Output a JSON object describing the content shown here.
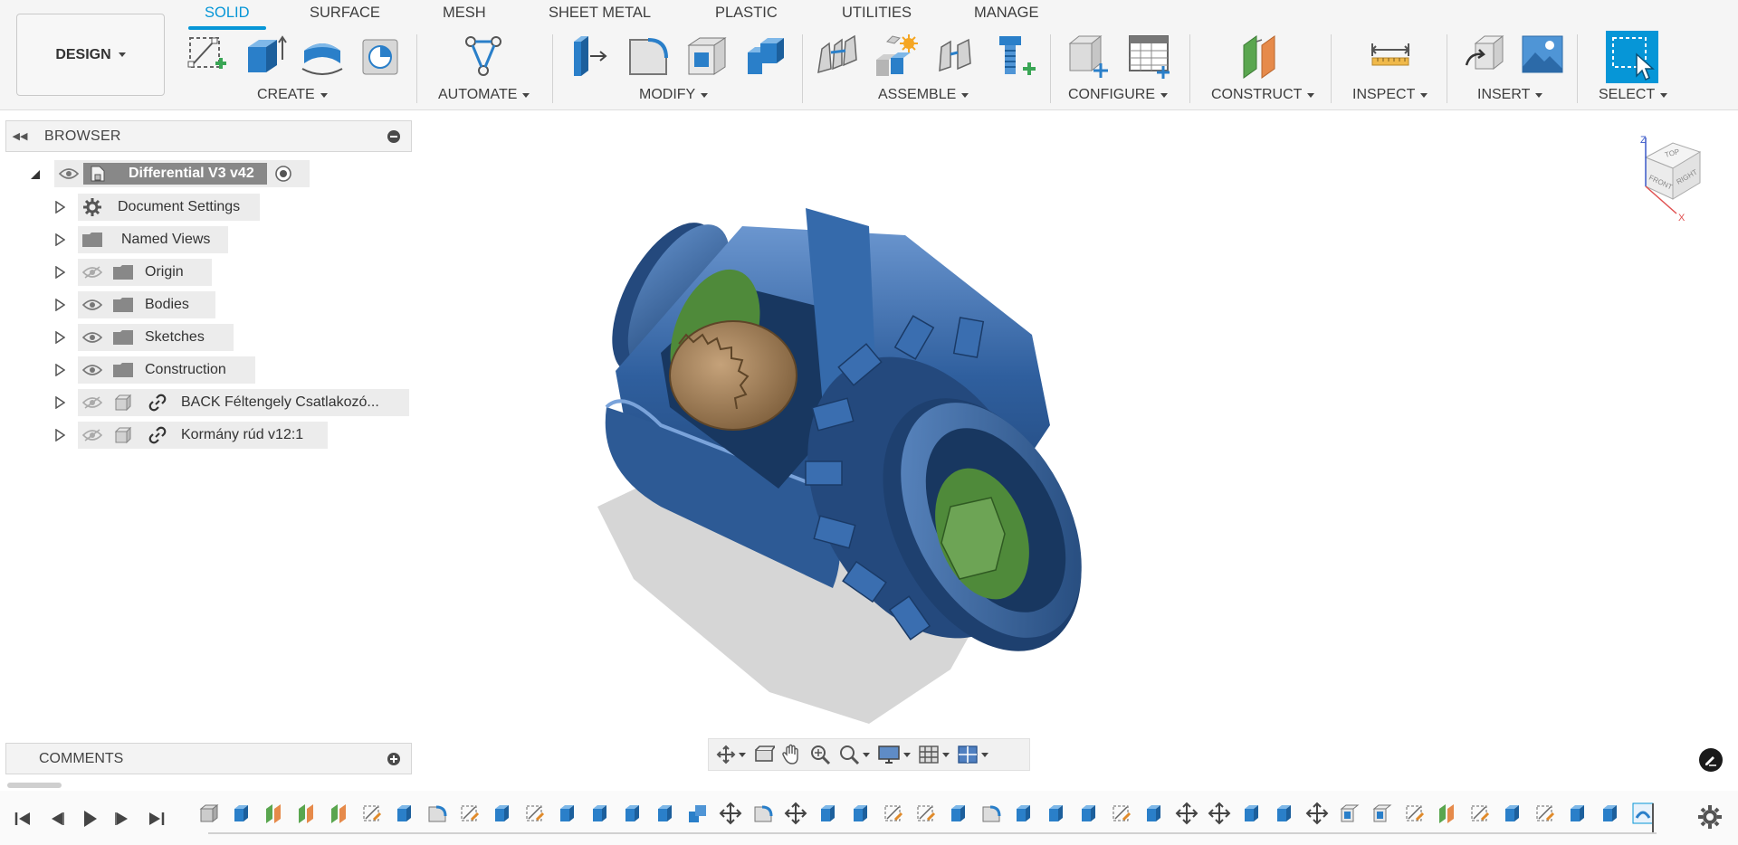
{
  "workspace": {
    "label": "DESIGN"
  },
  "tabs": [
    {
      "label": "SOLID",
      "active": true
    },
    {
      "label": "SURFACE",
      "active": false
    },
    {
      "label": "MESH",
      "active": false
    },
    {
      "label": "SHEET METAL",
      "active": false
    },
    {
      "label": "PLASTIC",
      "active": false
    },
    {
      "label": "UTILITIES",
      "active": false
    },
    {
      "label": "MANAGE",
      "active": false
    }
  ],
  "toolbar_groups": {
    "create": "CREATE",
    "automate": "AUTOMATE",
    "modify": "MODIFY",
    "assemble": "ASSEMBLE",
    "configure": "CONFIGURE",
    "construct": "CONSTRUCT",
    "inspect": "INSPECT",
    "insert": "INSERT",
    "select": "SELECT"
  },
  "toolbar_icons": {
    "create": [
      "create-sketch-icon",
      "extrude-icon",
      "revolve-icon",
      "hole-icon"
    ],
    "automate": [
      "automate-icon"
    ],
    "modify": [
      "press-pull-icon",
      "fillet-icon",
      "shell-icon",
      "combine-icon"
    ],
    "assemble": [
      "joint-icon",
      "new-component-icon",
      "as-built-joint-icon",
      "fastener-icon"
    ],
    "configure": [
      "configure-icon",
      "configuration-table-icon"
    ],
    "construct": [
      "offset-plane-icon"
    ],
    "inspect": [
      "measure-icon"
    ],
    "insert": [
      "insert-derive-icon",
      "insert-canvas-icon"
    ],
    "select": [
      "select-icon"
    ]
  },
  "browser": {
    "title": "BROWSER",
    "root": {
      "label": "Differential V3 v42"
    },
    "items": [
      {
        "label": "Document Settings",
        "icon": "gear-icon"
      },
      {
        "label": "Named Views",
        "icon": "folder-icon"
      },
      {
        "label": "Origin",
        "icon": "folder-icon",
        "visible": false
      },
      {
        "label": "Bodies",
        "icon": "folder-icon",
        "visible": true
      },
      {
        "label": "Sketches",
        "icon": "folder-icon",
        "visible": true
      },
      {
        "label": "Construction",
        "icon": "folder-icon",
        "visible": true
      },
      {
        "label": "BACK Féltengely Csatlakozó...",
        "icon": "component-icon",
        "visible": false,
        "linked": true
      },
      {
        "label": "Kormány rúd v12:1",
        "icon": "component-icon",
        "visible": false,
        "linked": true
      }
    ]
  },
  "comments": {
    "title": "COMMENTS"
  },
  "viewcube": {
    "top": "TOP",
    "front": "FRONT",
    "right": "RIGHT",
    "axis_z": "Z",
    "axis_x": "X"
  },
  "nav_bar": [
    "orbit-icon",
    "look-at-icon",
    "pan-icon",
    "zoom-icon",
    "fit-icon",
    "display-settings-icon",
    "grid-icon",
    "viewports-icon"
  ],
  "colors": {
    "accent": "#0696d7",
    "model_blue": "#2e5c96",
    "gear_bronze": "#9c7b52",
    "shaft_green": "#4f8a3a"
  },
  "timeline": {
    "controls": [
      "first-step-icon",
      "previous-step-icon",
      "play-icon",
      "next-step-icon",
      "last-step-icon"
    ],
    "feature_count": 45
  }
}
